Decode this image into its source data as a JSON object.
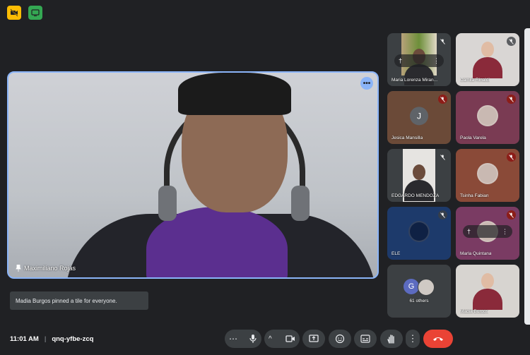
{
  "top_badges": [
    {
      "icon": "camera-off-icon",
      "color": "#fbbc04"
    },
    {
      "icon": "screen-share-icon",
      "color": "#34a853"
    }
  ],
  "main": {
    "name": "Maximiliano Rojas",
    "pinned": true
  },
  "tiles": [
    {
      "name": "Maria Lorenza Miran...",
      "bg": "#3c4043",
      "mic": "off",
      "style": "photo-green"
    },
    {
      "name": "Camila Rinaldi",
      "bg": "#d9d6d4",
      "mic": "off",
      "style": "photo-light"
    },
    {
      "name": "Jesica Mansilla",
      "bg": "#6b4a38",
      "mic": "off-red",
      "style": "letter",
      "letter": "J"
    },
    {
      "name": "Paola Varela",
      "bg": "#7a3b53",
      "mic": "off-red",
      "style": "avatar"
    },
    {
      "name": "EDGARDO MENDOZA",
      "bg": "#3c4043",
      "mic": "off",
      "style": "photo-white"
    },
    {
      "name": "Tsinha Fabian",
      "bg": "#8a4a38",
      "mic": "off-red",
      "style": "avatar"
    },
    {
      "name": "ELE",
      "bg": "#1d3a6b",
      "mic": "off",
      "style": "avatar-dark"
    },
    {
      "name": "Marla Quintana",
      "bg": "#7a3b63",
      "mic": "off-red",
      "style": "avatar-pinned"
    },
    {
      "name": "61 others",
      "bg": "#3c4043",
      "mic": "",
      "style": "others",
      "letter": "G"
    },
    {
      "name": "Madia Burgos",
      "bg": "#d7d4d0",
      "mic": "",
      "style": "photo-light"
    }
  ],
  "toast": "Madia Burgos pinned a tile for everyone.",
  "meeting": {
    "time": "11:01 AM",
    "separator": "|",
    "code": "qnq-yfbe-zcq"
  },
  "controls": [
    {
      "icon": "more-options-icon",
      "glyph": "⋯"
    },
    {
      "icon": "microphone-icon"
    },
    {
      "icon": "chevron-up-icon",
      "glyph": "^"
    },
    {
      "icon": "camera-icon"
    },
    {
      "icon": "present-icon"
    },
    {
      "icon": "emoji-icon"
    },
    {
      "icon": "captions-icon"
    },
    {
      "icon": "raise-hand-icon"
    },
    {
      "icon": "more-vert-icon",
      "glyph": "⋮"
    },
    {
      "icon": "leave-call-icon",
      "color": "#ea4335"
    }
  ]
}
